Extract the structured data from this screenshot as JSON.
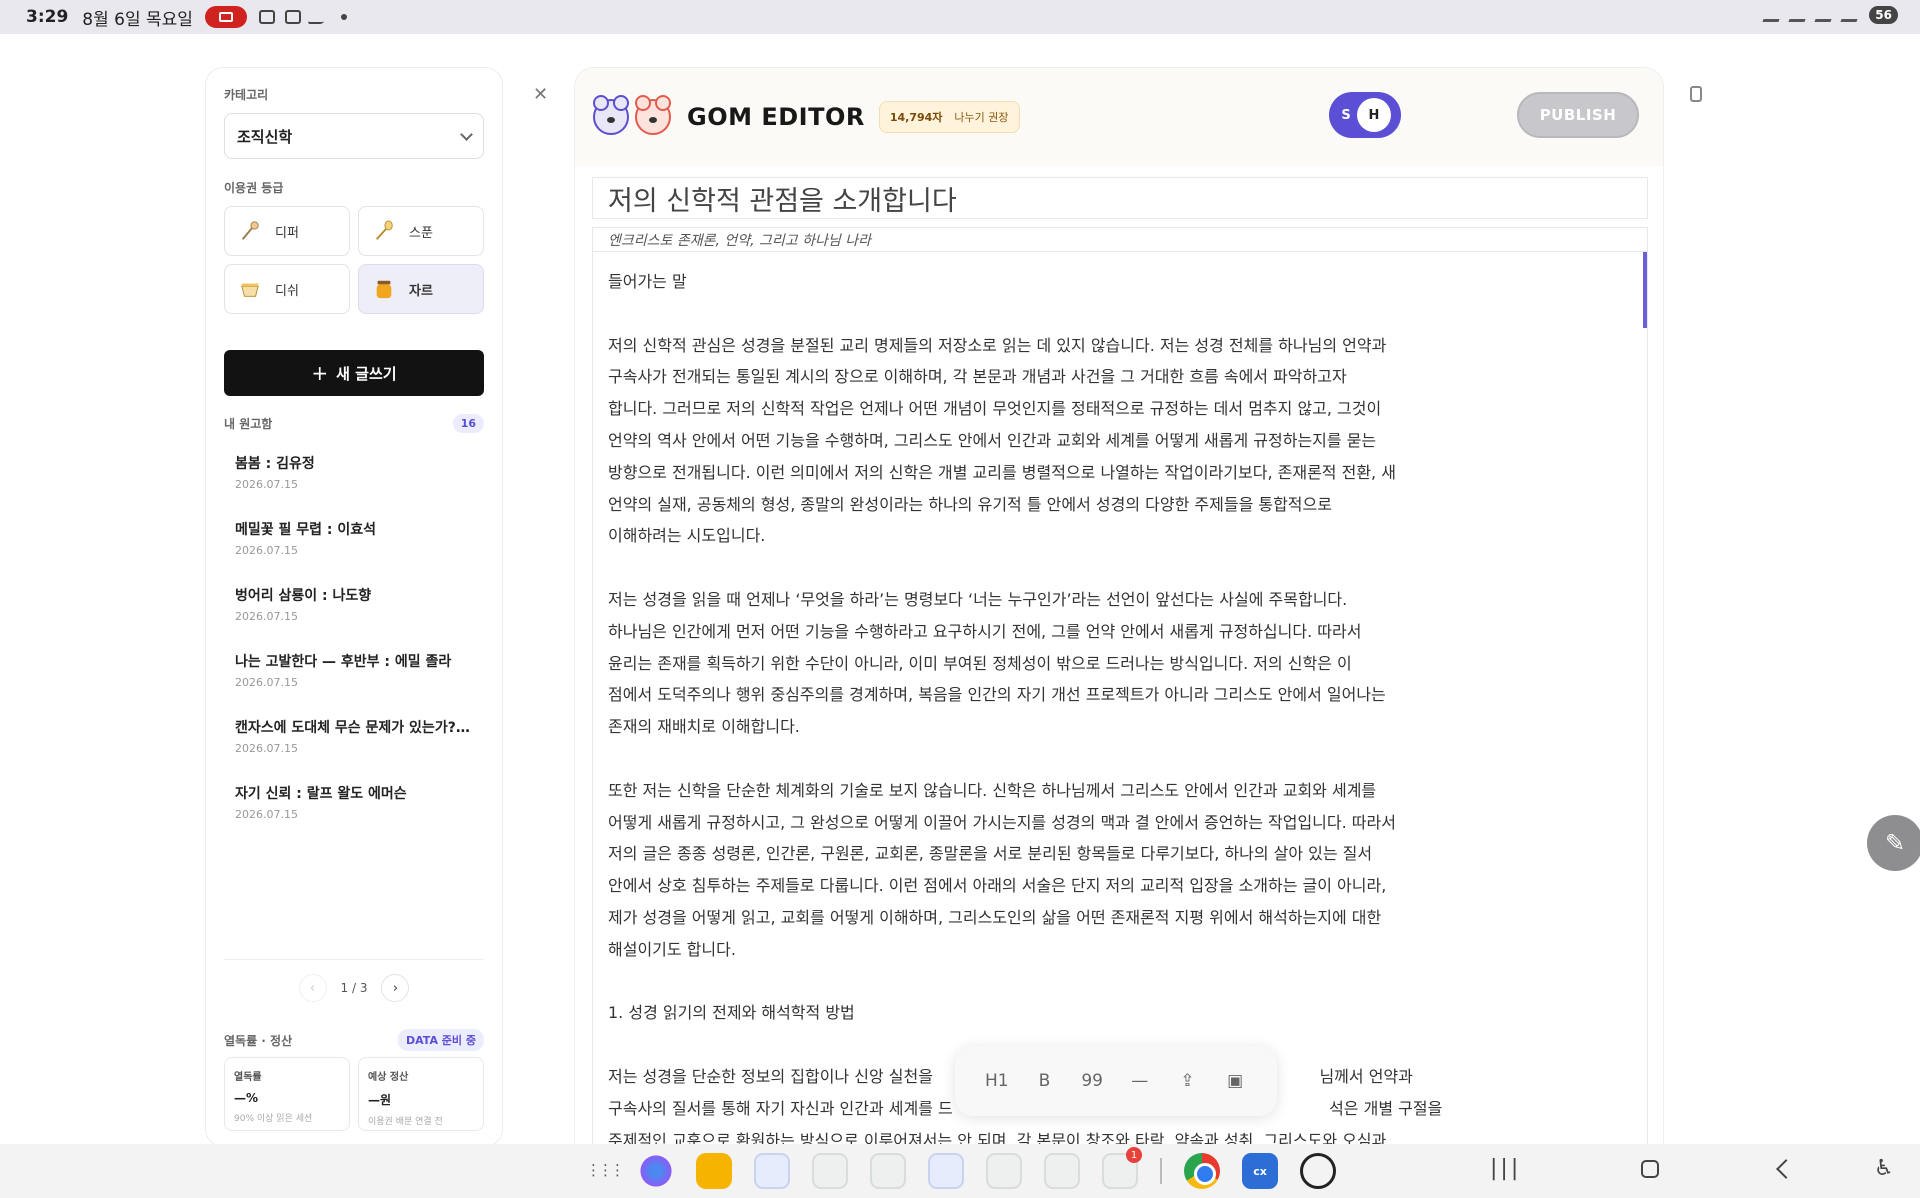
{
  "status_bar": {
    "time": "3:29",
    "date": "8월 6일 목요일",
    "battery": "56"
  },
  "sidebar": {
    "category_label": "카테고리",
    "category_value": "조직신학",
    "grade_label": "이용권 등급",
    "grades": [
      {
        "label": "디퍼",
        "icon": "ladle-icon",
        "active": false
      },
      {
        "label": "스푼",
        "icon": "spoon-icon",
        "active": false
      },
      {
        "label": "디쉬",
        "icon": "dish-icon",
        "active": false
      },
      {
        "label": "자르",
        "icon": "jar-icon",
        "active": true
      }
    ],
    "new_post_label": "새 글쓰기",
    "drafts_label": "내 원고함",
    "drafts_count": "16",
    "drafts": [
      {
        "title": "봄봄 : 김유정",
        "date": "2026.07.15"
      },
      {
        "title": "메밀꽃 필 무렵 : 이효석",
        "date": "2026.07.15"
      },
      {
        "title": "벙어리 삼룡이 : 나도향",
        "date": "2026.07.15"
      },
      {
        "title": "나는 고발한다 — 후반부 : 에밀 졸라",
        "date": "2026.07.15"
      },
      {
        "title": "캔자스에 도대체 무슨 문제가 있는가? : ...",
        "date": "2026.07.15"
      },
      {
        "title": "자기 신뢰 : 랄프 왈도 에머슨",
        "date": "2026.07.15"
      }
    ],
    "pager": "1 / 3",
    "stats_label": "열독률 · 정산",
    "stats_badge": "DATA 준비 중",
    "stats": [
      {
        "label": "열독률",
        "value": "—%",
        "hint": "90% 이상 읽은 세션"
      },
      {
        "label": "예상 정산",
        "value": "—원",
        "hint": "이용권 배분 연결 전"
      }
    ]
  },
  "editor": {
    "logo": "GOM EDITOR",
    "char_count": "14,794자",
    "char_hint": "나누기 권장",
    "toggle_s": "S",
    "toggle_h": "H",
    "publish_label": "PUBLISH",
    "title": "저의 신학적 관점을 소개합니다",
    "subtitle": "엔크리스토 존재론, 언약, 그리고 하나님 나라",
    "lines": [
      "들어가는 말",
      "",
      "저의 신학적 관심은 성경을 분절된 교리 명제들의 저장소로 읽는 데 있지 않습니다. 저는 성경 전체를 하나님의 언약과",
      "구속사가 전개되는 통일된 계시의 장으로 이해하며, 각 본문과 개념과 사건을 그 거대한 흐름 속에서 파악하고자",
      "합니다. 그러므로 저의 신학적 작업은 언제나 어떤 개념이 무엇인지를 정태적으로 규정하는 데서 멈추지 않고, 그것이",
      "언약의 역사 안에서 어떤 기능을 수행하며, 그리스도 안에서 인간과 교회와 세계를 어떻게 새롭게 규정하는지를 묻는",
      "방향으로 전개됩니다. 이런 의미에서 저의 신학은 개별 교리를 병렬적으로 나열하는 작업이라기보다, 존재론적 전환, 새",
      "언약의 실재, 공동체의 형성, 종말의 완성이라는 하나의 유기적 틀 안에서 성경의 다양한 주제들을 통합적으로",
      "이해하려는 시도입니다.",
      "",
      "저는 성경을 읽을 때 언제나 ‘무엇을 하라’는 명령보다 ‘너는 누구인가’라는 선언이 앞선다는 사실에 주목합니다.",
      "하나님은 인간에게 먼저 어떤 기능을 수행하라고 요구하시기 전에, 그를 언약 안에서 새롭게 규정하십니다. 따라서",
      "윤리는 존재를 획득하기 위한 수단이 아니라, 이미 부여된 정체성이 밖으로 드러나는 방식입니다. 저의 신학은 이",
      "점에서 도덕주의나 행위 중심주의를 경계하며, 복음을 인간의 자기 개선 프로젝트가 아니라 그리스도 안에서 일어나는",
      "존재의 재배치로 이해합니다.",
      "",
      "또한 저는 신학을 단순한 체계화의 기술로 보지 않습니다. 신학은 하나님께서 그리스도 안에서 인간과 교회와 세계를",
      "어떻게 새롭게 규정하시고, 그 완성으로 어떻게 이끌어 가시는지를 성경의 맥과 결 안에서 증언하는 작업입니다. 따라서",
      "저의 글은 종종 성령론, 인간론, 구원론, 교회론, 종말론을 서로 분리된 항목들로 다루기보다, 하나의 살아 있는 질서",
      "안에서 상호 침투하는 주제들로 다룹니다. 이런 점에서 아래의 서술은 단지 저의 교리적 입장을 소개하는 글이 아니라,",
      "제가 성경을 어떻게 읽고, 교회를 어떻게 이해하며, 그리스도인의 삶을 어떤 존재론적 지평 위에서 해석하는지에 대한",
      "해설이기도 합니다.",
      "",
      "1. 성경 읽기의 전제와 해석학적 방법",
      "",
      "저는 성경을 단순한 정보의 집합이나 신앙 실천을                                                                            님께서 언약과",
      "구속사의 질서를 통해 자기 자신과 인간과 세계를 드                                                                          석은 개별 구절을",
      "주제적인 교훈으로 환원하는 방식으로 이루어져서는 안 되며, 각 본문이 창조와 타락, 약속과 성취, 그리스도와 오심과"
    ]
  },
  "format_toolbar": {
    "h1": "H1",
    "bold": "B",
    "quote": "99",
    "rule": "—",
    "upload": "⇪",
    "image": "▣"
  }
}
